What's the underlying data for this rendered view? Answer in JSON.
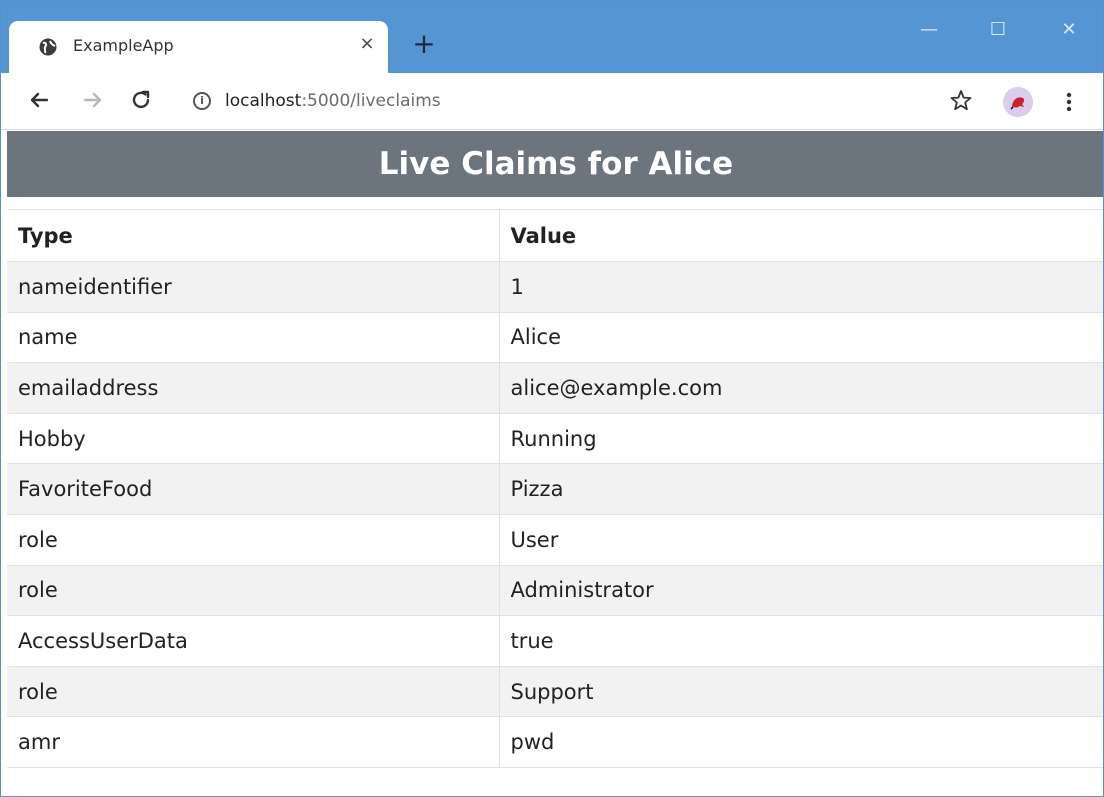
{
  "browser": {
    "tab_title": "ExampleApp",
    "tab_close": "×",
    "new_tab": "+",
    "window_controls": {
      "minimize": "—",
      "maximize": "☐",
      "close": "✕"
    },
    "url_host": "localhost",
    "url_path": ":5000/liveclaims",
    "icons": [
      "globe-icon",
      "back-arrow-icon",
      "forward-arrow-icon",
      "reload-icon",
      "info-icon",
      "star-icon",
      "avatar",
      "more-menu-icon"
    ]
  },
  "page": {
    "title": "Live Claims for Alice",
    "header_color": "#6c757d",
    "columns": [
      "Type",
      "Value"
    ],
    "rows": [
      [
        "nameidentifier",
        "1"
      ],
      [
        "name",
        "Alice"
      ],
      [
        "emailaddress",
        "alice@example.com"
      ],
      [
        "Hobby",
        "Running"
      ],
      [
        "FavoriteFood",
        "Pizza"
      ],
      [
        "role",
        "User"
      ],
      [
        "role",
        "Administrator"
      ],
      [
        "AccessUserData",
        "true"
      ],
      [
        "role",
        "Support"
      ],
      [
        "amr",
        "pwd"
      ]
    ]
  }
}
